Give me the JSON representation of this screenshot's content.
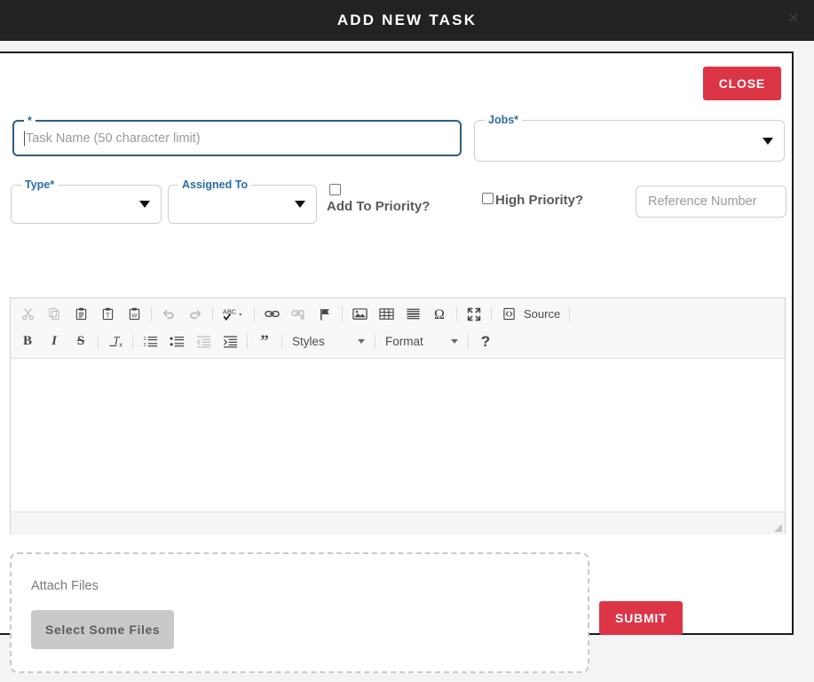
{
  "titlebar": {
    "title": "ADD NEW TASK",
    "close_icon": "close-icon"
  },
  "colors": {
    "titlebar_bg": "#222222",
    "accent_red": "#dc3545",
    "label_blue": "#2b6ca3",
    "focus_border": "#2f5d80",
    "page_bg": "#f4f4f4",
    "button_gray": "#c9c9c9"
  },
  "form": {
    "close_button": "CLOSE",
    "task_name": {
      "label": "*",
      "placeholder": "Task Name (50 character limit)",
      "value": ""
    },
    "jobs": {
      "label": "Jobs*",
      "value": ""
    },
    "type": {
      "label": "Type*",
      "value": ""
    },
    "assigned_to": {
      "label": "Assigned To",
      "value": ""
    },
    "add_to_priority": {
      "label": "Add To Priority?",
      "checked": false
    },
    "high_priority": {
      "label": "High Priority?",
      "checked": false
    },
    "reference_number": {
      "placeholder": "Reference Number",
      "value": ""
    }
  },
  "editor": {
    "content": "",
    "toolbar_row1": [
      {
        "name": "cut-icon",
        "title": "Cut",
        "disabled": true
      },
      {
        "name": "copy-icon",
        "title": "Copy",
        "disabled": true
      },
      {
        "name": "paste-icon",
        "title": "Paste",
        "disabled": false
      },
      {
        "name": "paste-as-text-icon",
        "title": "Paste as plain text",
        "disabled": false
      },
      {
        "name": "paste-from-word-icon",
        "title": "Paste from Word",
        "disabled": false
      },
      {
        "name": "separator",
        "title": "",
        "disabled": false
      },
      {
        "name": "undo-icon",
        "title": "Undo",
        "disabled": true
      },
      {
        "name": "redo-icon",
        "title": "Redo",
        "disabled": true
      },
      {
        "name": "separator",
        "title": "",
        "disabled": false
      },
      {
        "name": "spellcheck-icon",
        "title": "Spell Check As You Type",
        "disabled": false
      },
      {
        "name": "separator",
        "title": "",
        "disabled": false
      },
      {
        "name": "link-icon",
        "title": "Link",
        "disabled": false
      },
      {
        "name": "unlink-icon",
        "title": "Unlink",
        "disabled": true
      },
      {
        "name": "anchor-flag-icon",
        "title": "Anchor",
        "disabled": false
      },
      {
        "name": "separator",
        "title": "",
        "disabled": false
      },
      {
        "name": "image-icon",
        "title": "Image",
        "disabled": false
      },
      {
        "name": "table-icon",
        "title": "Table",
        "disabled": false
      },
      {
        "name": "horizontal-rule-icon",
        "title": "Horizontal Line",
        "disabled": false
      },
      {
        "name": "special-character-icon",
        "title": "Insert Special Character",
        "disabled": false
      },
      {
        "name": "separator",
        "title": "",
        "disabled": false
      },
      {
        "name": "maximize-icon",
        "title": "Maximize",
        "disabled": false
      },
      {
        "name": "separator",
        "title": "",
        "disabled": false
      },
      {
        "name": "source-icon",
        "title": "Source",
        "disabled": false
      }
    ],
    "source_label": "Source",
    "toolbar_row2": [
      {
        "name": "bold-icon",
        "title": "Bold",
        "glyph": "B",
        "disabled": false
      },
      {
        "name": "italic-icon",
        "title": "Italic",
        "glyph": "I",
        "disabled": false
      },
      {
        "name": "strikethrough-icon",
        "title": "Strikethrough",
        "glyph": "S",
        "disabled": false
      },
      {
        "name": "separator",
        "title": "",
        "glyph": "",
        "disabled": false
      },
      {
        "name": "remove-format-icon",
        "title": "Remove Format",
        "glyph": "",
        "disabled": false
      },
      {
        "name": "separator",
        "title": "",
        "glyph": "",
        "disabled": false
      },
      {
        "name": "numbered-list-icon",
        "title": "Insert/Remove Numbered List",
        "glyph": "",
        "disabled": false
      },
      {
        "name": "bulleted-list-icon",
        "title": "Insert/Remove Bulleted List",
        "glyph": "",
        "disabled": false
      },
      {
        "name": "decrease-indent-icon",
        "title": "Decrease Indent",
        "glyph": "",
        "disabled": true
      },
      {
        "name": "increase-indent-icon",
        "title": "Increase Indent",
        "glyph": "",
        "disabled": false
      },
      {
        "name": "separator",
        "title": "",
        "glyph": "",
        "disabled": false
      },
      {
        "name": "blockquote-icon",
        "title": "Block Quote",
        "glyph": "",
        "disabled": false
      },
      {
        "name": "separator",
        "title": "",
        "glyph": "",
        "disabled": false
      }
    ],
    "styles_combo": "Styles",
    "format_combo": "Format",
    "about_glyph": "?"
  },
  "attach": {
    "title": "Attach Files",
    "select_button": "Select Some Files"
  },
  "submit_button": "SUBMIT"
}
